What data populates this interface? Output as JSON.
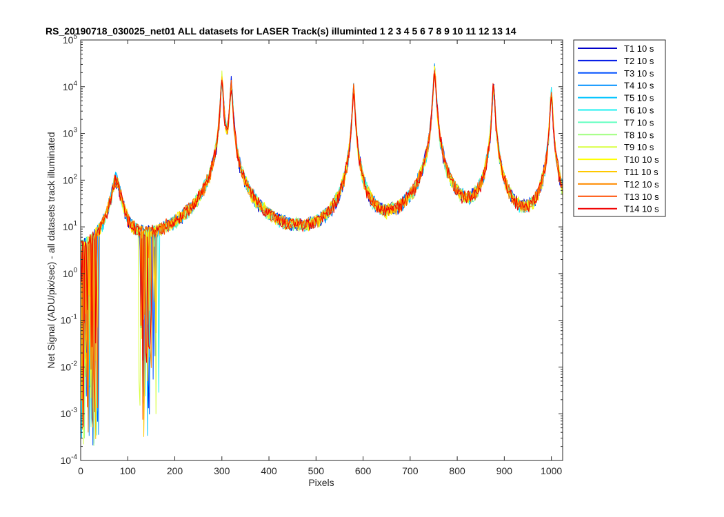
{
  "chart_data": {
    "type": "line",
    "title": "RS_20190718_030025_net01 ALL datasets for LASER  Track(s) illuminted 1   2   3   4   5   6   7   8   9  10  11  12  13  14",
    "xlabel": "Pixels",
    "ylabel": "Net Signal (ADU/pix/sec) - all datasets track illuminated",
    "xlim": [
      0,
      1024
    ],
    "ylim": [
      0.0001,
      100000
    ],
    "yscale": "log",
    "grid": false,
    "legend_position": "outside-right",
    "x_ticks": [
      "0",
      "100",
      "200",
      "300",
      "400",
      "500",
      "600",
      "700",
      "800",
      "900",
      "1000"
    ],
    "x_tick_values": [
      0,
      100,
      200,
      300,
      400,
      500,
      600,
      700,
      800,
      900,
      1000
    ],
    "y_tick_exponents": [
      -4,
      -3,
      -2,
      -1,
      0,
      1,
      2,
      3,
      4,
      5
    ],
    "y_ticks": [
      {
        "base": "10",
        "exp": "-4"
      },
      {
        "base": "10",
        "exp": "-3"
      },
      {
        "base": "10",
        "exp": "-2"
      },
      {
        "base": "10",
        "exp": "-1"
      },
      {
        "base": "10",
        "exp": "0"
      },
      {
        "base": "10",
        "exp": "1"
      },
      {
        "base": "10",
        "exp": "2"
      },
      {
        "base": "10",
        "exp": "3"
      },
      {
        "base": "10",
        "exp": "4"
      },
      {
        "base": "10",
        "exp": "5"
      }
    ],
    "peaks": [
      {
        "x": 75,
        "height": 100
      },
      {
        "x": 300,
        "height": 15000
      },
      {
        "x": 320,
        "height": 12000
      },
      {
        "x": 580,
        "height": 9000
      },
      {
        "x": 752,
        "height": 24000
      },
      {
        "x": 877,
        "height": 11000
      },
      {
        "x": 1000,
        "height": 7500
      }
    ],
    "baseline_level": 1.0,
    "noise_floor_min": 0.0001,
    "series": [
      {
        "name": "T1 10 s",
        "color": "#0000c8"
      },
      {
        "name": "T2 10 s",
        "color": "#0018e6"
      },
      {
        "name": "T3 10 s",
        "color": "#0050ff"
      },
      {
        "name": "T4 10 s",
        "color": "#0090ff"
      },
      {
        "name": "T5 10 s",
        "color": "#00c4ff"
      },
      {
        "name": "T6 10 s",
        "color": "#19f0f0"
      },
      {
        "name": "T7 10 s",
        "color": "#60ffc0"
      },
      {
        "name": "T8 10 s",
        "color": "#a0ff80"
      },
      {
        "name": "T9 10 s",
        "color": "#d8ff40"
      },
      {
        "name": "T10 10 s",
        "color": "#ffff00"
      },
      {
        "name": "T11 10 s",
        "color": "#ffc800"
      },
      {
        "name": "T12 10 s",
        "color": "#ff8c00"
      },
      {
        "name": "T13 10 s",
        "color": "#ff4c00"
      },
      {
        "name": "T14 10 s",
        "color": "#f00000"
      }
    ]
  }
}
